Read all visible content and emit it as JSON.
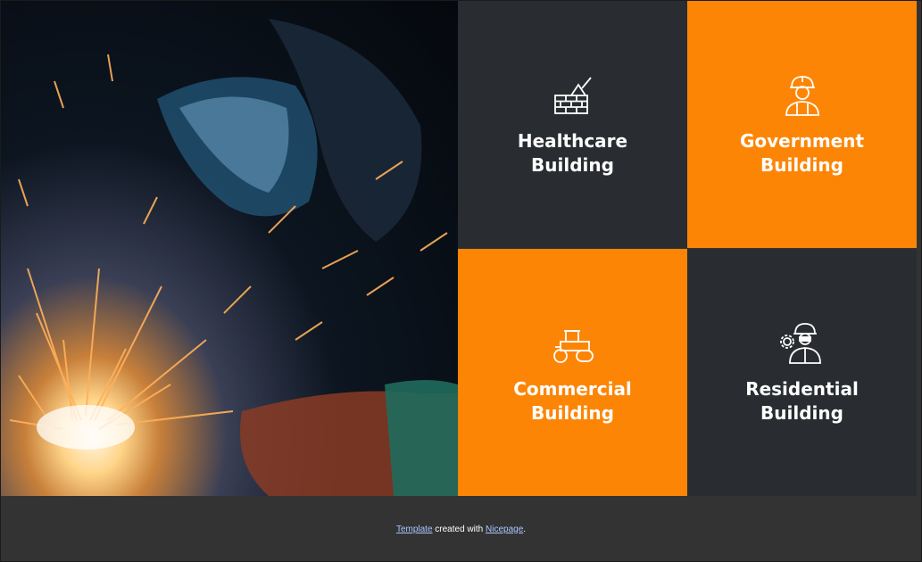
{
  "tiles": [
    {
      "title": "Healthcare Building",
      "icon": "brick-wall-trowel-icon"
    },
    {
      "title": "Government Building",
      "icon": "construction-worker-icon"
    },
    {
      "title": "Commercial Building",
      "icon": "road-roller-icon"
    },
    {
      "title": "Residential Building",
      "icon": "engineer-gear-icon"
    }
  ],
  "footer": {
    "template_link": "Template",
    "middle_text": " created with ",
    "nicepage_link": "Nicepage",
    "end_text": "."
  },
  "colors": {
    "dark_tile": "#292d31",
    "orange_tile": "#fd8505",
    "footer_bg": "#333333",
    "link": "#a8c8ff"
  }
}
